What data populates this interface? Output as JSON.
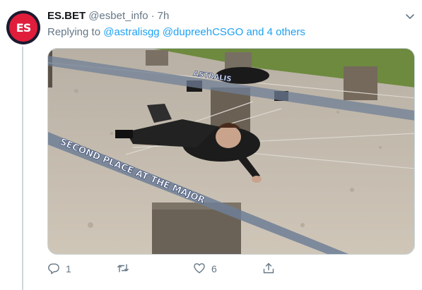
{
  "tweet": {
    "display_name": "ES.BET",
    "handle": "@esbet_info",
    "separator": "·",
    "time": "7h",
    "avatar_text": "ES",
    "reply": {
      "prefix": "Replying to",
      "mention1": "@astralisgg",
      "mention2": "@dupreehCSGO",
      "others": "and 4 others"
    },
    "image": {
      "caption_top": "ASTRALIS",
      "caption_bottom": "SECOND PLACE AT THE MAJOR"
    },
    "actions": {
      "reply_icon": "reply-icon",
      "reply_count": "1",
      "retweet_icon": "retweet-icon",
      "like_icon": "heart-icon",
      "like_count": "6",
      "share_icon": "share-icon"
    }
  },
  "colors": {
    "link": "#1da1f2",
    "muted": "#657786",
    "text": "#14171a",
    "brand": "#e11d3c"
  }
}
